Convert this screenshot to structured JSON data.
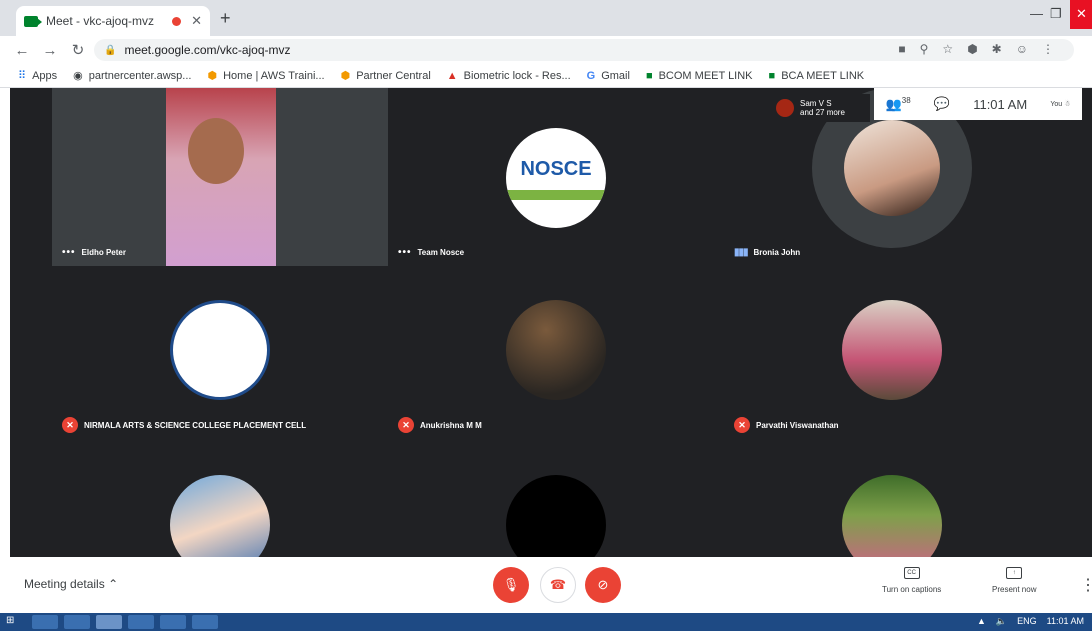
{
  "browser": {
    "tab_title": "Meet - vkc-ajoq-mvz",
    "url": "meet.google.com/vkc-ajoq-mvz",
    "bookmarks": [
      "Apps",
      "partnercenter.awsp...",
      "Home | AWS Traini...",
      "Partner Central",
      "Biometric lock - Res...",
      "Gmail",
      "BCOM MEET LINK",
      "BCA MEET LINK"
    ]
  },
  "meet": {
    "presenter_chip": {
      "line1": "Sam V S",
      "line2": "and 27 more"
    },
    "participants_count": "38",
    "time": "11:01 AM",
    "you_label": "You",
    "tiles": [
      {
        "name": "Eldho Peter"
      },
      {
        "name": "Team Nosce"
      },
      {
        "name": "Bronia John"
      },
      {
        "name": "NIRMALA ARTS & SCIENCE COLLEGE PLACEMENT CELL"
      },
      {
        "name": "Anukrishna M M"
      },
      {
        "name": "Parvathi Viswanathan"
      }
    ],
    "nosce_logo_text": "NOSCE"
  },
  "controls": {
    "meeting_details": "Meeting details",
    "captions": "Turn on captions",
    "present": "Present now"
  },
  "taskbar": {
    "lang": "ENG",
    "clock": "11:01 AM"
  }
}
